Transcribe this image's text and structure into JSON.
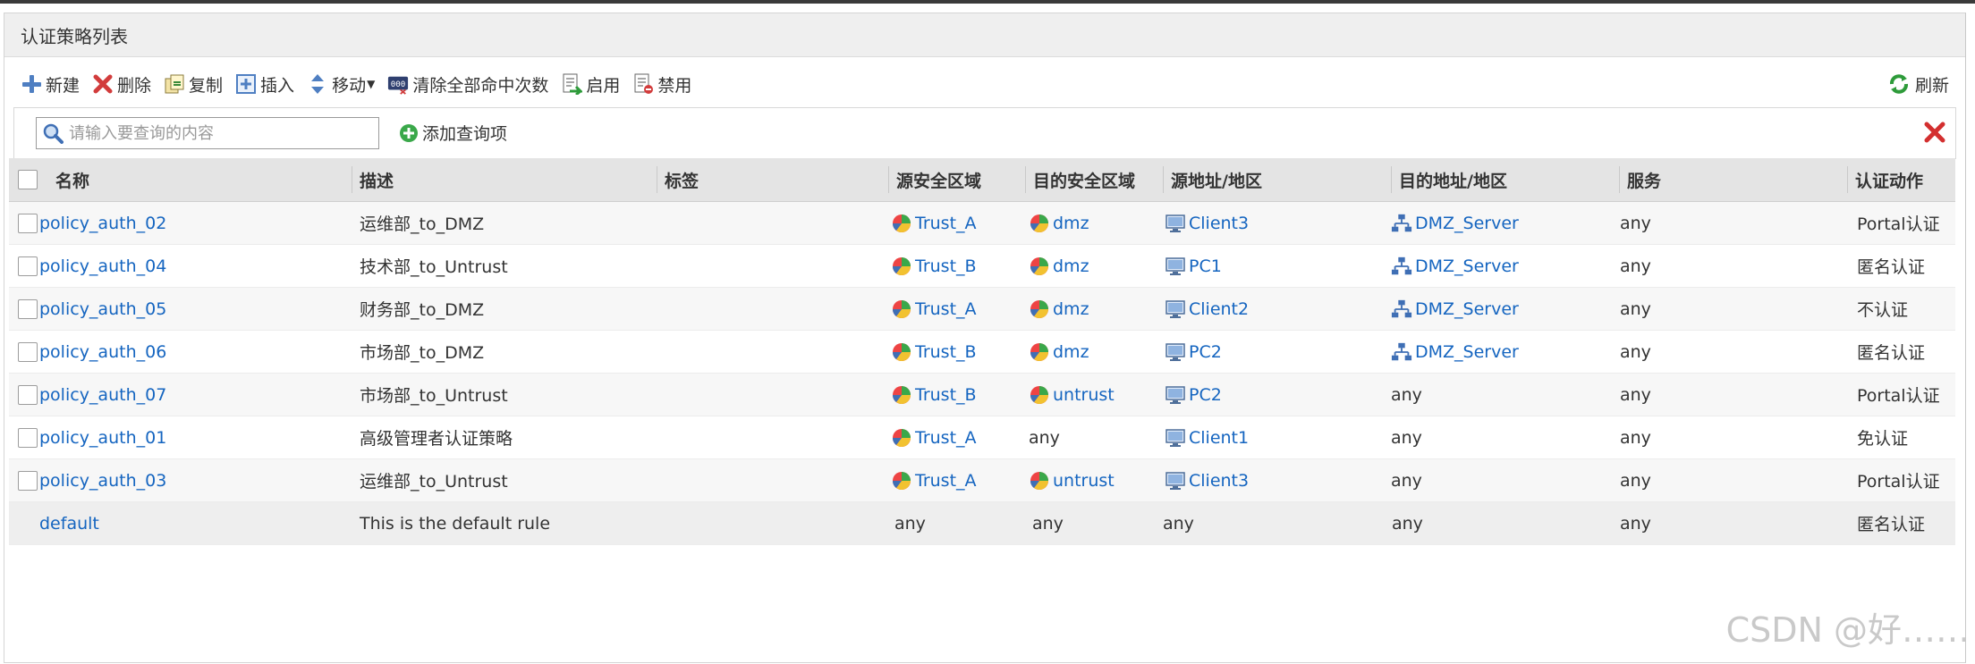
{
  "panel": {
    "title": "认证策略列表"
  },
  "toolbar": {
    "new_label": "新建",
    "delete_label": "删除",
    "copy_label": "复制",
    "insert_label": "插入",
    "move_label": "移动",
    "clear_hits_label": "清除全部命中次数",
    "enable_label": "启用",
    "disable_label": "禁用",
    "refresh_label": "刷新"
  },
  "search": {
    "placeholder": "请输入要查询的内容",
    "add_query_label": "添加查询项"
  },
  "table": {
    "headers": {
      "name": "名称",
      "desc": "描述",
      "tag": "标签",
      "src_zone": "源安全区域",
      "dst_zone": "目的安全区域",
      "src_addr": "源地址/地区",
      "dst_addr": "目的地址/地区",
      "service": "服务",
      "action": "认证动作"
    },
    "rows": [
      {
        "name": "policy_auth_02",
        "desc": "运维部_to_DMZ",
        "src_zone": "Trust_A",
        "dst_zone": "dmz",
        "src_addr": "Client3",
        "dst_addr": "DMZ_Server",
        "service": "any",
        "action": "Portal认证"
      },
      {
        "name": "policy_auth_04",
        "desc": "技术部_to_Untrust",
        "src_zone": "Trust_B",
        "dst_zone": "dmz",
        "src_addr": "PC1",
        "dst_addr": "DMZ_Server",
        "service": "any",
        "action": "匿名认证"
      },
      {
        "name": "policy_auth_05",
        "desc": "财务部_to_DMZ",
        "src_zone": "Trust_A",
        "dst_zone": "dmz",
        "src_addr": "Client2",
        "dst_addr": "DMZ_Server",
        "service": "any",
        "action": "不认证"
      },
      {
        "name": "policy_auth_06",
        "desc": "市场部_to_DMZ",
        "src_zone": "Trust_B",
        "dst_zone": "dmz",
        "src_addr": "PC2",
        "dst_addr": "DMZ_Server",
        "service": "any",
        "action": "匿名认证"
      },
      {
        "name": "policy_auth_07",
        "desc": "市场部_to_Untrust",
        "src_zone": "Trust_B",
        "dst_zone": "untrust",
        "src_addr": "PC2",
        "dst_addr": "any",
        "service": "any",
        "action": "Portal认证"
      },
      {
        "name": "policy_auth_01",
        "desc": "高级管理者认证策略",
        "src_zone": "Trust_A",
        "dst_zone": "any",
        "src_addr": "Client1",
        "dst_addr": "any",
        "service": "any",
        "action": "免认证"
      },
      {
        "name": "policy_auth_03",
        "desc": "运维部_to_Untrust",
        "src_zone": "Trust_A",
        "dst_zone": "untrust",
        "src_addr": "Client3",
        "dst_addr": "any",
        "service": "any",
        "action": "Portal认证"
      }
    ],
    "default_row": {
      "name": "default",
      "desc": "This is the default rule",
      "src_zone": "any",
      "dst_zone": "any",
      "src_addr": "any",
      "dst_addr": "any",
      "service": "any",
      "action": "匿名认证"
    }
  },
  "watermark": "CSDN @好……",
  "colors": {
    "link": "#1565c0",
    "header_bg": "#e4e4e4",
    "close_red": "#d32f2f"
  }
}
